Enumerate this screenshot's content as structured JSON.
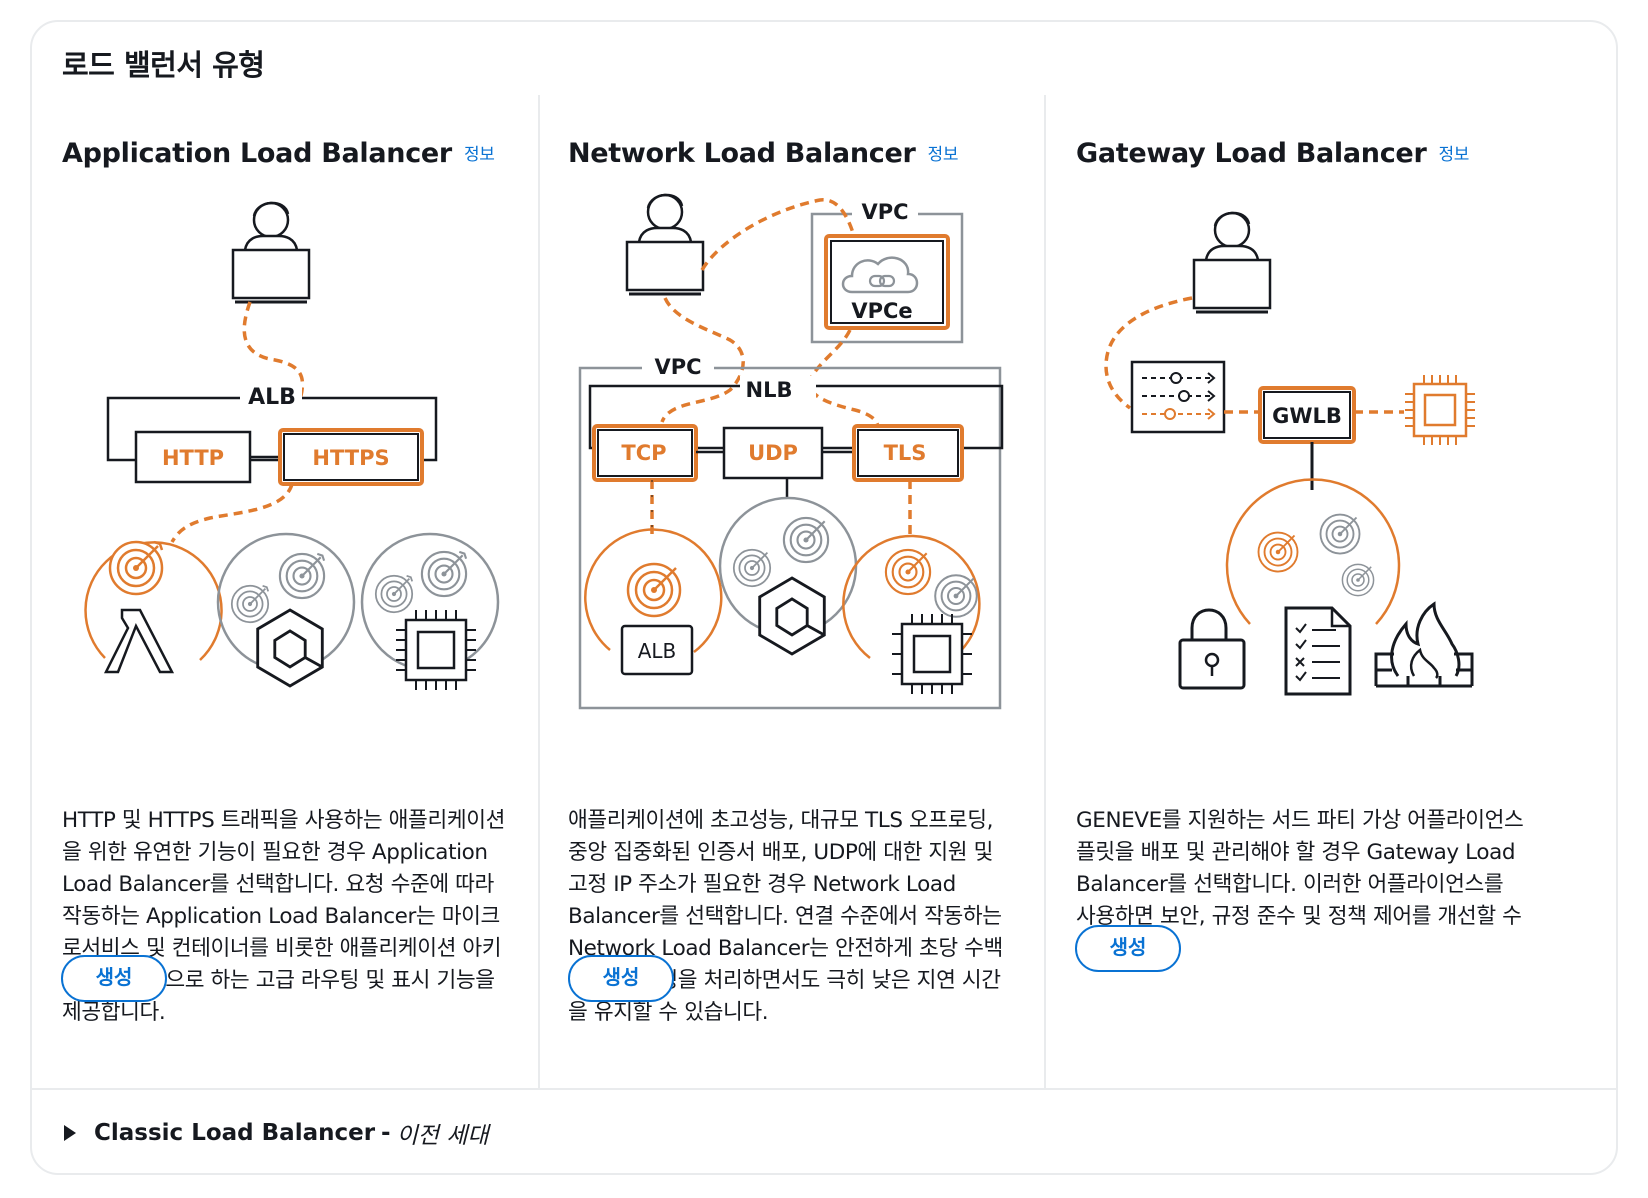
{
  "panel": {
    "title": "로드 밸런서 유형"
  },
  "cards": [
    {
      "title": "Application Load Balancer",
      "info": "정보",
      "diagram": {
        "group": "ALB",
        "left_box": "HTTP",
        "right_box": "HTTPS"
      },
      "description": "HTTP 및 HTTPS 트래픽을 사용하는 애플리케이션을 위한 유연한 기능이 필요한 경우 Application Load Balancer를 선택합니다. 요청 수준에 따라 작동하는 Application Load Balancer는 마이크로서비스 및 컨테이너를 비롯한 애플리케이션 아키텍처를 대상으로 하는 고급 라우팅 및 표시 기능을 제공합니다.",
      "button": "생성"
    },
    {
      "title": "Network Load Balancer",
      "info": "정보",
      "diagram": {
        "vpc_top": "VPC",
        "vpce": "VPCe",
        "vpc": "VPC",
        "group": "NLB",
        "box1": "TCP",
        "box2": "UDP",
        "box3": "TLS",
        "target": "ALB"
      },
      "description": "애플리케이션에 초고성능, 대규모 TLS 오프로딩, 중앙 집중화된 인증서 배포, UDP에 대한 지원 및 고정 IP 주소가 필요한 경우 Network Load Balancer를 선택합니다. 연결 수준에서 작동하는 Network Load Balancer는 안전하게 초당 수백만 개의 요청을 처리하면서도 극히 낮은 지연 시간을 유지할 수 있습니다.",
      "button": "생성"
    },
    {
      "title": "Gateway Load Balancer",
      "info": "정보",
      "diagram": {
        "box": "GWLB"
      },
      "description": "GENEVE를 지원하는 서드 파티 가상 어플라이언스 플릿을 배포 및 관리해야 할 경우 Gateway Load Balancer를 선택합니다. 이러한 어플라이언스를 사용하면 보안, 규정 준수 및 정책 제어를 개선할 수 있습니다.",
      "button": "생성"
    }
  ],
  "classic": {
    "name": "Classic Load Balancer",
    "separator": "-",
    "generation": "이전 세대"
  },
  "colors": {
    "accent": "#e07b2e",
    "link": "#0972d3",
    "gray": "#8d9399",
    "border": "#e9ebed",
    "text": "#16191f"
  }
}
